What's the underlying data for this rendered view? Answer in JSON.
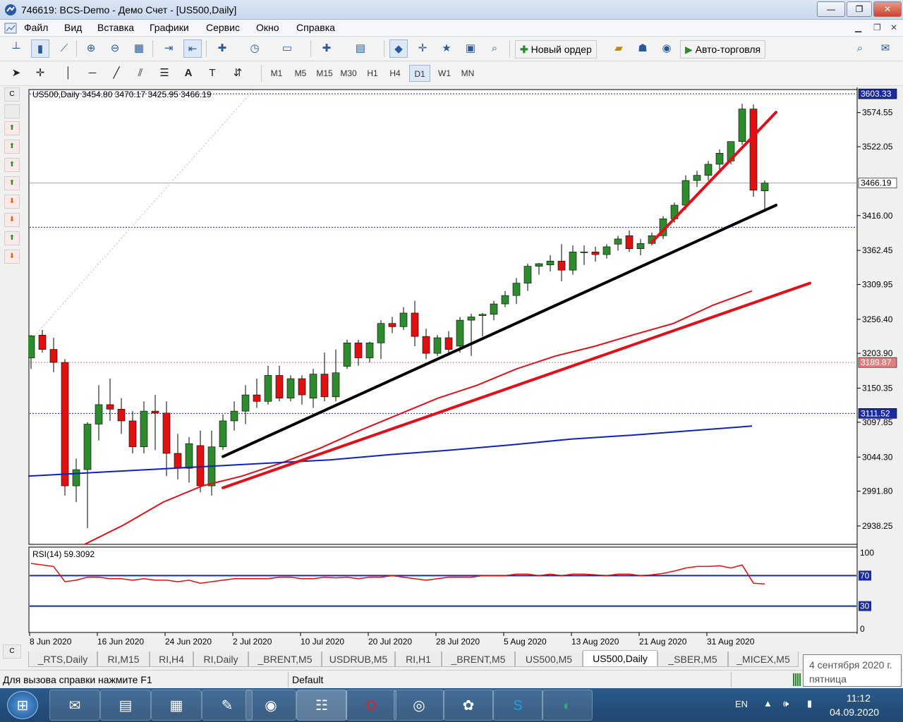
{
  "window": {
    "title": "746619: BCS-Demo - Демо Счет - [US500,Daily]",
    "minimize": "—",
    "restore": "❐",
    "close": "✕"
  },
  "menu": [
    "Файл",
    "Вид",
    "Вставка",
    "Графики",
    "Сервис",
    "Окно",
    "Справка"
  ],
  "toolbar": {
    "new_order": "Новый ордер",
    "autotrading": "Авто-торговля"
  },
  "timeframes": [
    "M1",
    "M5",
    "M15",
    "M30",
    "H1",
    "H4",
    "D1",
    "W1",
    "MN"
  ],
  "active_timeframe": "D1",
  "chart": {
    "header": "US500,Daily  3454.80 3470.17 3425.95 3466.19",
    "price_labels": [
      "3574.55",
      "3522.05",
      "3416.00",
      "3362.45",
      "3309.95",
      "3256.40",
      "3203.90",
      "3150.35",
      "3097.85",
      "3044.30",
      "2991.80",
      "2938.25"
    ],
    "marked_prices": {
      "top": "3603.33",
      "current": "3466.19",
      "pink": "3189.87",
      "blue": "3111.52"
    },
    "date_labels": [
      "8 Jun 2020",
      "16 Jun 2020",
      "24 Jun 2020",
      "2 Jul 2020",
      "10 Jul 2020",
      "20 Jul 2020",
      "28 Jul 2020",
      "5 Aug 2020",
      "13 Aug 2020",
      "21 Aug 2020",
      "31 Aug 2020"
    ],
    "rsi_header": "RSI(14) 59.3092",
    "rsi_levels": [
      "100",
      "70",
      "30",
      "0"
    ]
  },
  "chart_data": {
    "type": "candlestick",
    "candles": [
      [
        3197,
        3231,
        3180,
        3232
      ],
      [
        3232,
        3210,
        3205,
        3240
      ],
      [
        3210,
        3190,
        3175,
        3228
      ],
      [
        3190,
        3000,
        2985,
        3195
      ],
      [
        3000,
        3025,
        2975,
        3042
      ],
      [
        3025,
        3095,
        2935,
        3098
      ],
      [
        3095,
        3125,
        3070,
        3155
      ],
      [
        3125,
        3118,
        3100,
        3165
      ],
      [
        3118,
        3100,
        3080,
        3135
      ],
      [
        3100,
        3060,
        3050,
        3115
      ],
      [
        3060,
        3115,
        3050,
        3130
      ],
      [
        3115,
        3112,
        3055,
        3140
      ],
      [
        3112,
        3050,
        3015,
        3130
      ],
      [
        3050,
        3027,
        3010,
        3080
      ],
      [
        3027,
        3065,
        3005,
        3075
      ],
      [
        3062,
        3000,
        2990,
        3085
      ],
      [
        3000,
        3060,
        2985,
        3085
      ],
      [
        3060,
        3100,
        3055,
        3110
      ],
      [
        3100,
        3115,
        3085,
        3130
      ],
      [
        3115,
        3140,
        3095,
        3155
      ],
      [
        3140,
        3130,
        3120,
        3165
      ],
      [
        3130,
        3170,
        3125,
        3185
      ],
      [
        3170,
        3135,
        3130,
        3185
      ],
      [
        3135,
        3165,
        3130,
        3170
      ],
      [
        3165,
        3140,
        3125,
        3170
      ],
      [
        3135,
        3172,
        3120,
        3180
      ],
      [
        3172,
        3137,
        3130,
        3205
      ],
      [
        3137,
        3174,
        3130,
        3210
      ],
      [
        3184,
        3220,
        3180,
        3225
      ],
      [
        3220,
        3197,
        3185,
        3225
      ],
      [
        3197,
        3220,
        3190,
        3222
      ],
      [
        3220,
        3250,
        3195,
        3255
      ],
      [
        3250,
        3245,
        3235,
        3260
      ],
      [
        3245,
        3266,
        3240,
        3275
      ],
      [
        3266,
        3230,
        3215,
        3285
      ],
      [
        3230,
        3204,
        3195,
        3242
      ],
      [
        3204,
        3228,
        3200,
        3232
      ],
      [
        3228,
        3210,
        3205,
        3238
      ],
      [
        3215,
        3255,
        3205,
        3260
      ],
      [
        3255,
        3260,
        3200,
        3265
      ],
      [
        3262,
        3264,
        3230,
        3266
      ],
      [
        3264,
        3280,
        3255,
        3285
      ],
      [
        3280,
        3293,
        3275,
        3300
      ],
      [
        3293,
        3312,
        3280,
        3320
      ],
      [
        3312,
        3338,
        3300,
        3342
      ],
      [
        3338,
        3342,
        3325,
        3343
      ],
      [
        3340,
        3346,
        3330,
        3355
      ],
      [
        3346,
        3332,
        3315,
        3372
      ],
      [
        3332,
        3360,
        3325,
        3370
      ],
      [
        3360,
        3360,
        3340,
        3370
      ],
      [
        3360,
        3356,
        3345,
        3368
      ],
      [
        3356,
        3368,
        3350,
        3372
      ],
      [
        3372,
        3380,
        3362,
        3385
      ],
      [
        3385,
        3365,
        3360,
        3393
      ],
      [
        3365,
        3373,
        3355,
        3380
      ],
      [
        3373,
        3385,
        3370,
        3390
      ],
      [
        3385,
        3411,
        3380,
        3415
      ],
      [
        3411,
        3432,
        3405,
        3436
      ],
      [
        3432,
        3470,
        3425,
        3478
      ],
      [
        3470,
        3478,
        3460,
        3485
      ],
      [
        3478,
        3495,
        3470,
        3500
      ],
      [
        3495,
        3512,
        3485,
        3518
      ],
      [
        3500,
        3530,
        3495,
        3530
      ],
      [
        3530,
        3580,
        3525,
        3588
      ],
      [
        3580,
        3455,
        3445,
        3587
      ],
      [
        3454,
        3466,
        3426,
        3470
      ]
    ],
    "price_min": 2910,
    "price_max": 3610,
    "moving_averages": [
      {
        "name": "MA red",
        "color": "#e0101a",
        "values": [
          2910,
          2940,
          2975,
          3000,
          3015,
          3035,
          3058,
          3085,
          3110,
          3135,
          3155,
          3180,
          3200,
          3215,
          3233,
          3250,
          3278,
          3300
        ]
      },
      {
        "name": "MA blue",
        "color": "#1020c0",
        "values": [
          3015,
          3020,
          3025,
          3030,
          3035,
          3040,
          3048,
          3055,
          3063,
          3072,
          3078,
          3085,
          3092
        ]
      }
    ],
    "trendlines": [
      {
        "color": "#000000",
        "from": [
          3045,
          17
        ],
        "to": [
          3432,
          66
        ]
      },
      {
        "color": "#e0101a",
        "from": [
          2997,
          17
        ],
        "to": [
          3312,
          69
        ]
      },
      {
        "color": "#e0101a",
        "from": [
          3375,
          55
        ],
        "to": [
          3575,
          66
        ]
      }
    ],
    "rsi": [
      86,
      84,
      82,
      62,
      64,
      68,
      68,
      66,
      66,
      64,
      66,
      64,
      64,
      62,
      64,
      60,
      62,
      64,
      66,
      66,
      66,
      66,
      68,
      68,
      66,
      66,
      68,
      67,
      68,
      66,
      68,
      68,
      70,
      68,
      66,
      64,
      66,
      68,
      68,
      68,
      70,
      70,
      70,
      72,
      72,
      70,
      72,
      70,
      72,
      72,
      71,
      70,
      72,
      72,
      70,
      71,
      73,
      76,
      80,
      82,
      82,
      83,
      80,
      84,
      60,
      59
    ]
  },
  "tabs": [
    "_RTS,Daily",
    "RI,M15",
    "RI,H4",
    "RI,Daily",
    "_BRENT,M5",
    "USDRUB,M5",
    "RI,H1",
    "_BRENT,M5",
    "US500,M5",
    "US500,Daily",
    "_SBER,M5",
    "_MICEX,M5"
  ],
  "active_tab": "US500,Daily",
  "status": {
    "help": "Для вызова справки нажмите F1",
    "profile": "Default"
  },
  "tooltip": {
    "date": "4 сентября 2020 г.",
    "day": "пятница"
  },
  "taskbar": {
    "lang": "EN",
    "time": "11:12",
    "date": "04.09.2020"
  }
}
